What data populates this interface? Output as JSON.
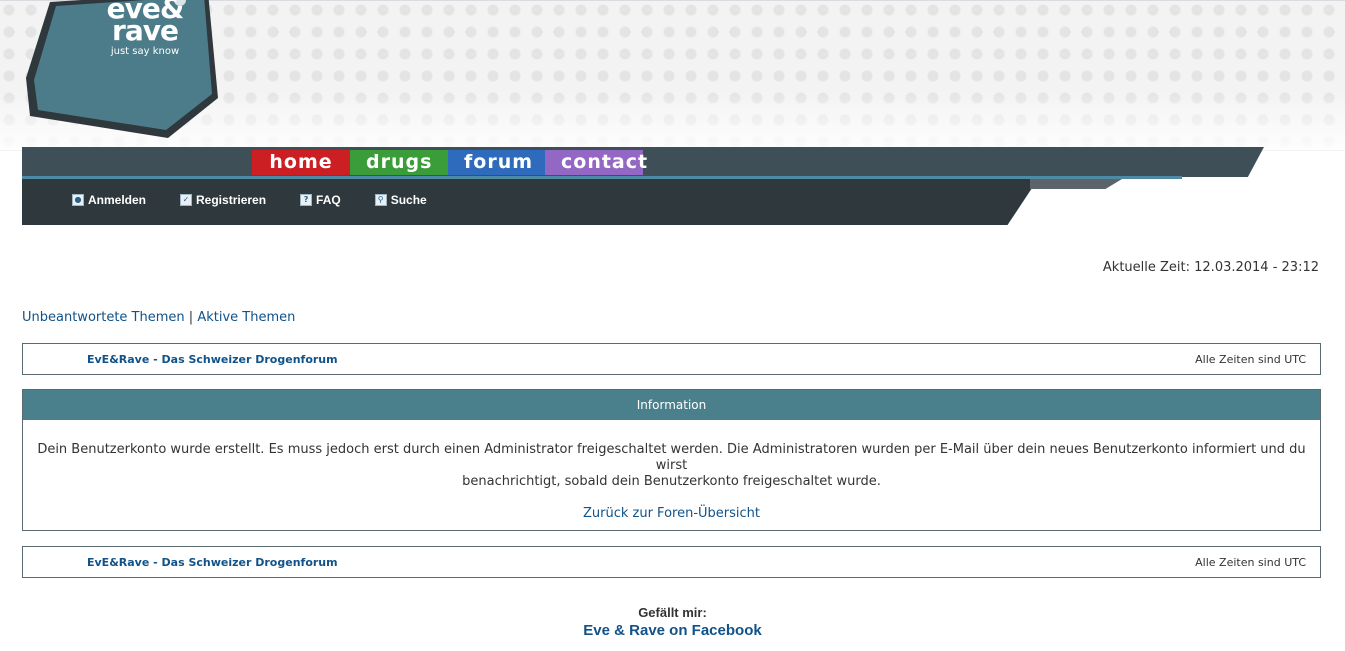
{
  "logo": {
    "line1": "eve&",
    "line2": "rave",
    "tagline": "just say know"
  },
  "main_nav": [
    {
      "label": "home"
    },
    {
      "label": "drugs"
    },
    {
      "label": "forum"
    },
    {
      "label": "contact"
    }
  ],
  "sub_nav": [
    {
      "label": "Anmelden",
      "icon": "login-icon"
    },
    {
      "label": "Registrieren",
      "icon": "register-icon"
    },
    {
      "label": "FAQ",
      "icon": "faq-icon"
    },
    {
      "label": "Suche",
      "icon": "search-icon"
    }
  ],
  "current_time": "Aktuelle Zeit: 12.03.2014 - 23:12",
  "quicklinks": {
    "unanswered": "Unbeantwortete Themen",
    "separator": "|",
    "active": "Aktive Themen"
  },
  "navbar": {
    "crumb": "EvE&Rave - Das Schweizer Drogenforum",
    "timezone": "Alle Zeiten sind UTC"
  },
  "info": {
    "heading": "Information",
    "message_line1": "Dein Benutzerkonto wurde erstellt. Es muss jedoch erst durch einen Administrator freigeschaltet werden. Die Administratoren wurden per E-Mail über dein neues Benutzerkonto informiert und du wirst",
    "message_line2": "benachrichtigt, sobald dein Benutzerkonto freigeschaltet wurde.",
    "back_link": "Zurück zur Foren-Übersicht"
  },
  "footer": {
    "like_label": "Gefällt mir:",
    "facebook_link": "Eve & Rave on Facebook"
  },
  "colors": {
    "home": "#cc1f24",
    "drugs": "#3b9d3a",
    "forum": "#2e6bbd",
    "contact": "#9367c4",
    "bar_dark": "#2f383d",
    "header_teal": "#4a7f8c",
    "link": "#105289"
  }
}
